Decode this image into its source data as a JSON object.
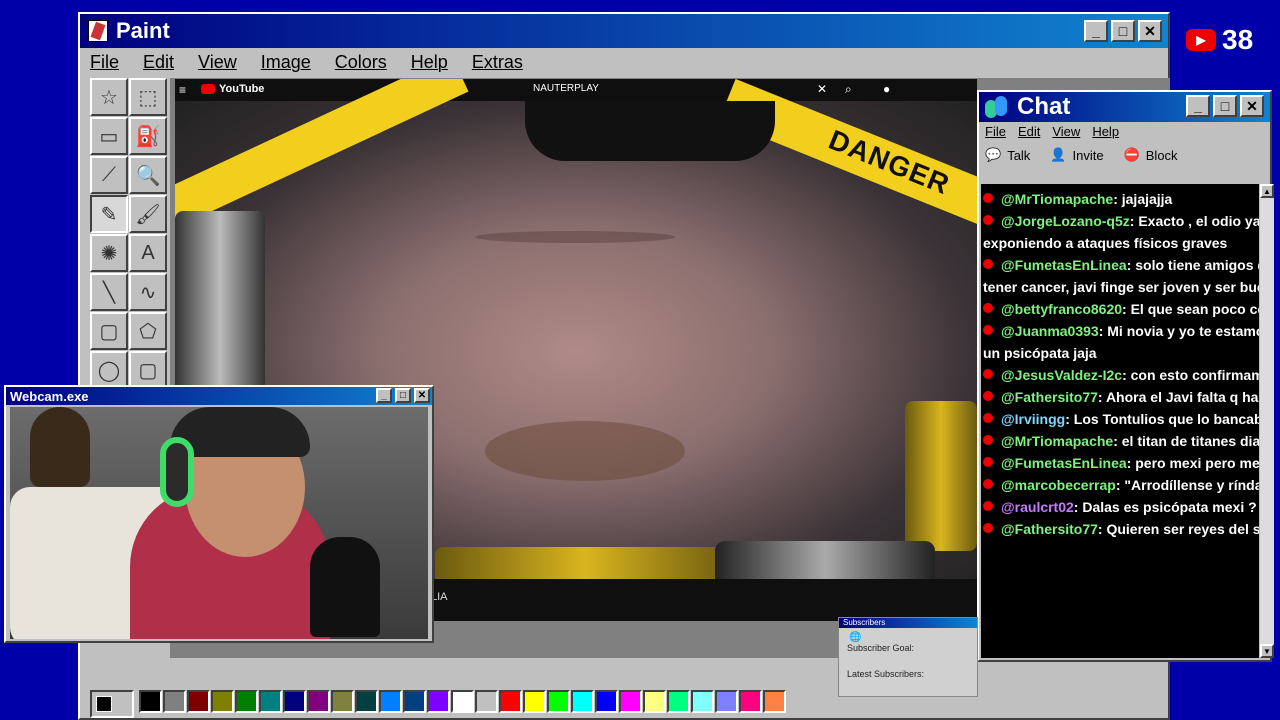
{
  "paint": {
    "title": "Paint",
    "menu": [
      "File",
      "Edit",
      "View",
      "Image",
      "Colors",
      "Help",
      "Extras"
    ],
    "tools": [
      "free-select-icon",
      "rect-select-icon",
      "eraser-icon",
      "fill-icon",
      "color-picker-icon",
      "magnifier-icon",
      "pencil-icon",
      "brush-icon",
      "airbrush-icon",
      "text-icon",
      "line-icon",
      "curve-icon",
      "rectangle-icon",
      "polygon-icon",
      "ellipse-icon",
      "rounded-rect-icon"
    ],
    "palette": [
      "#000000",
      "#808080",
      "#800000",
      "#808000",
      "#008000",
      "#008080",
      "#000080",
      "#800080",
      "#808040",
      "#004040",
      "#0080ff",
      "#004080",
      "#8000ff",
      "#ffffff",
      "#c0c0c0",
      "#ff0000",
      "#ffff00",
      "#00ff00",
      "#00ffff",
      "#0000ff",
      "#ff00ff",
      "#ffff80",
      "#00ff80",
      "#80ffff",
      "#8080ff",
      "#ff0080",
      "#ff8040"
    ]
  },
  "video": {
    "yt_logo": "YouTube",
    "channel": "NAUTERPLAY",
    "danger_text": "DANGER",
    "caption_fragment": "LIA"
  },
  "webcam": {
    "title": "Webcam.exe"
  },
  "chat": {
    "title": "Chat",
    "menu": [
      "File",
      "Edit",
      "View",
      "Help"
    ],
    "toolbar": [
      {
        "icon": "talk-icon",
        "label": "Talk"
      },
      {
        "icon": "invite-icon",
        "label": "Invite"
      },
      {
        "icon": "block-icon",
        "label": "Block"
      }
    ],
    "messages": [
      {
        "user": "@MrTiomapache",
        "text": ": jajajajja",
        "color": "green"
      },
      {
        "user": "@JorgeLozano-q5z",
        "text": ": Exacto , el odio ya está",
        "cont": "exponiendo a ataques físicos graves",
        "color": "green"
      },
      {
        "user": "@FumetasEnLinea",
        "text": ": solo tiene amigos que f",
        "cont": "tener cancer, javi finge ser joven y ser buena pe",
        "color": "green"
      },
      {
        "user": "@bettyfranco8620",
        "text": ": El que sean poco comu",
        "color": "green"
      },
      {
        "user": "@Juanma0393",
        "text": ": Mi novia y yo te estamos",
        "cont": "un psicópata jaja",
        "color": "green"
      },
      {
        "user": "@JesusValdez-I2c",
        "text": ": con esto confirmamos",
        "color": "green"
      },
      {
        "user": "@Fathersito77",
        "text": ": Ahora el Javi falta q haga un",
        "color": "green"
      },
      {
        "user": "@Irviingg",
        "text": ": Los Tontulios que lo bancaban y",
        "color": "blue"
      },
      {
        "user": "@MrTiomapache",
        "text": ": el titan de titanes diagno",
        "color": "green"
      },
      {
        "user": "@FumetasEnLinea",
        "text": ": pero mexi pero mexi pe",
        "color": "green"
      },
      {
        "user": "@marcobecerrap",
        "text": ": \"Arrodíllense y ríndanme",
        "color": "green"
      },
      {
        "user": "@raulcrt02",
        "text": ": Dalas es psicópata mexi ?",
        "color": "purple"
      },
      {
        "user": "@Fathersito77",
        "text": ": Quieren ser reyes del salse",
        "color": "green"
      }
    ]
  },
  "yt_counter": {
    "value": "38"
  },
  "subscribers_widget": {
    "title": "Subscribers",
    "goal_label": "Subscriber Goal:",
    "latest_label": "Latest Subscribers:"
  }
}
